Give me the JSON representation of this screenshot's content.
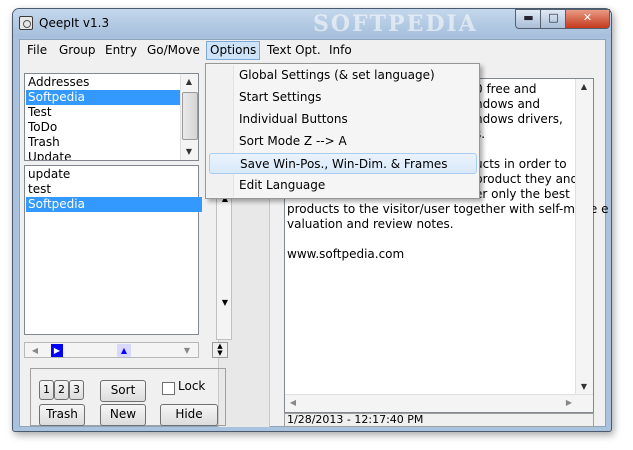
{
  "window": {
    "title": "QeepIt v1.3",
    "watermark": "SOFTPEDIA",
    "min_glyph": "▬",
    "max_glyph": "□",
    "close_glyph": "✕"
  },
  "menubar": [
    "File",
    "Group",
    "Entry",
    "Go/Move",
    "Options",
    "Text Opt.",
    "Info"
  ],
  "groups_list": {
    "items": [
      "Addresses",
      "Softpedia",
      "Test",
      "ToDo",
      "Trash",
      "Update"
    ],
    "selected_index": 1
  },
  "entries_list": {
    "items": [
      "update",
      "test",
      "Softpedia"
    ],
    "selected_index": 2
  },
  "buttons": {
    "one": "1",
    "two": "2",
    "three": "3",
    "sort": "Sort",
    "lock": "Lock",
    "trash": "Trash",
    "new": "New",
    "hide": "Hide"
  },
  "editor": {
    "lines": [
      "0 free and",
      "ndows and",
      "ndows drivers,",
      "s.",
      "",
      "ucts in order to",
      "product they and",
      "er only the best",
      "products to the visitor/user together with self-made e",
      "valuation and review notes.",
      "",
      "www.softpedia.com"
    ],
    "status": "1/28/2013 - 12:17:40 PM"
  },
  "options_menu": {
    "items": [
      "Global Settings (& set language)",
      "Start Settings",
      "Individual Buttons",
      "Sort Mode Z --> A",
      "Save Win-Pos., Win-Dim. & Frames",
      "Edit Language"
    ],
    "highlighted_index": 4
  },
  "colors": {
    "selection": "#3399ff",
    "title_bar": "#a9c3df",
    "close_button": "#c4391c",
    "menu_highlight": "#cde3f8"
  }
}
